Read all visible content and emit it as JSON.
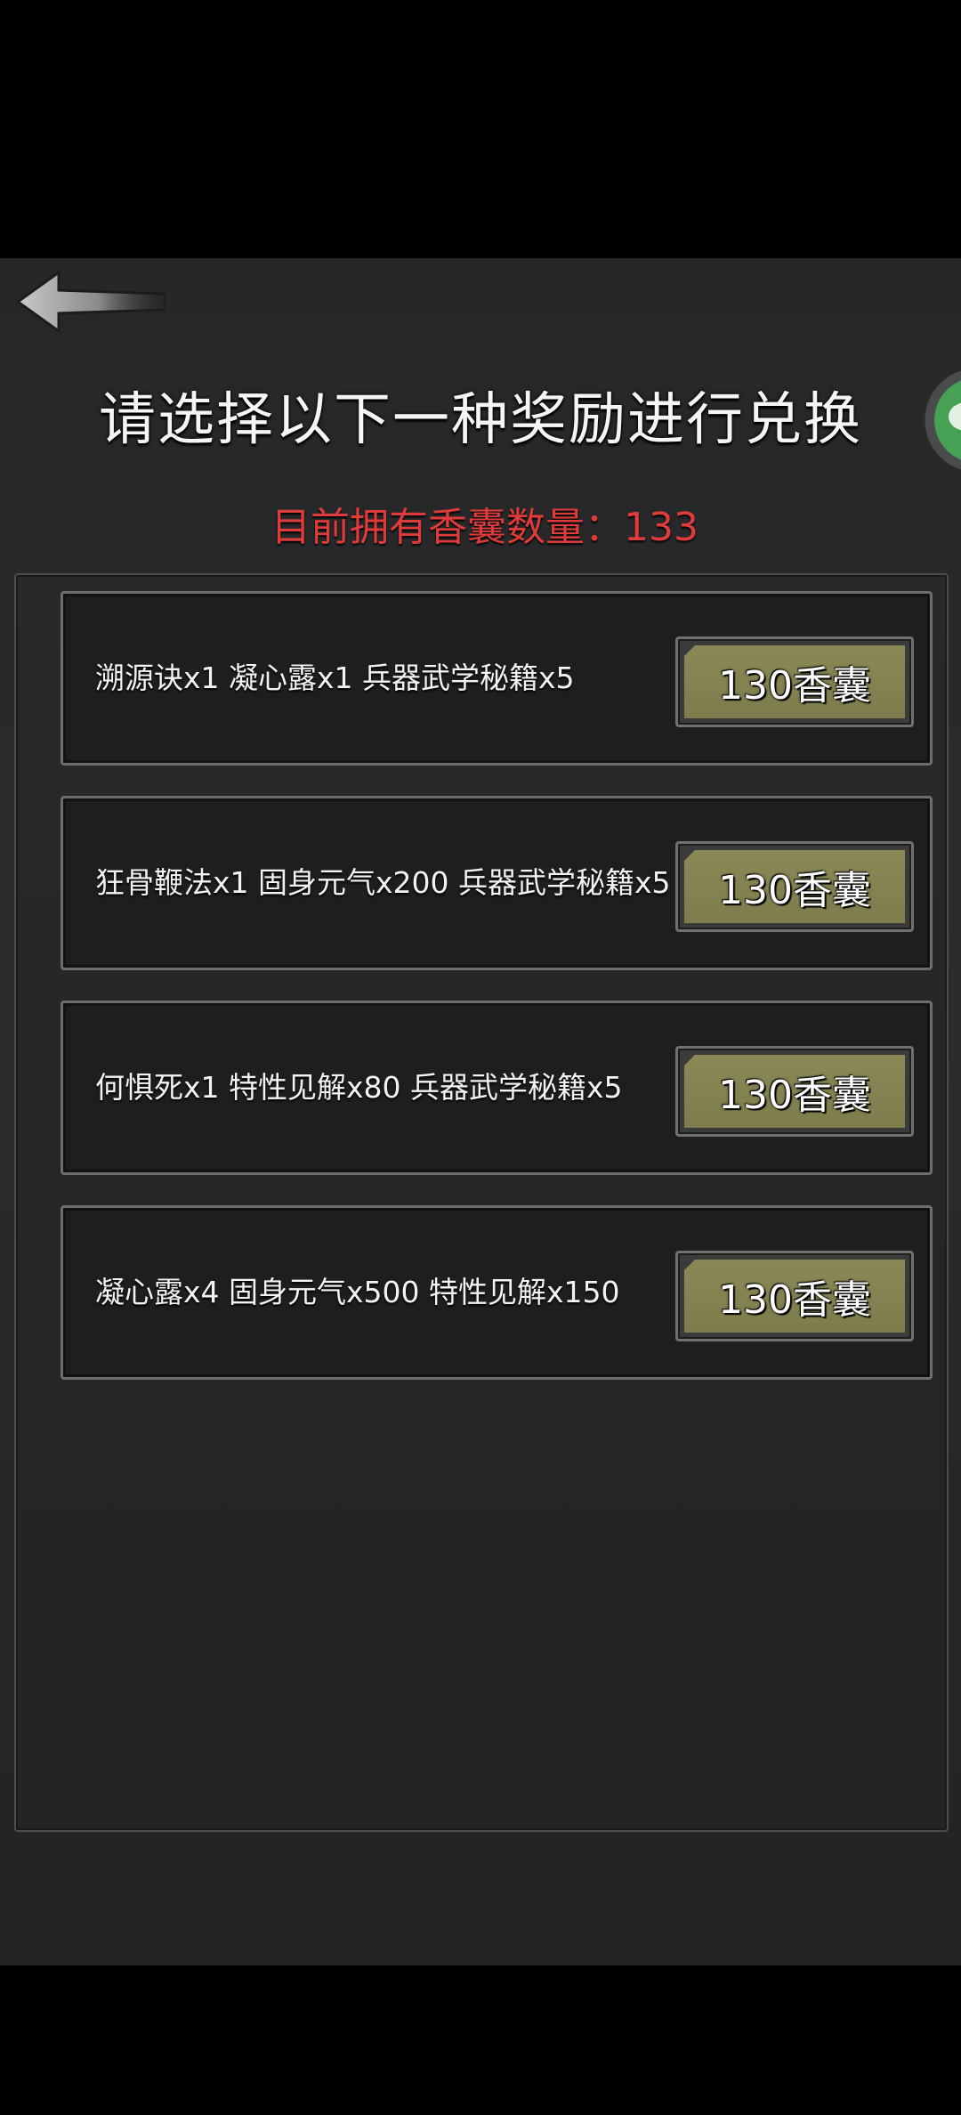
{
  "header": {
    "title": "请选择以下一种奖励进行兑换",
    "count_text": "目前拥有香囊数量：133"
  },
  "icons": {
    "back": "back-arrow-icon",
    "side": "chat-bubble-icon"
  },
  "rewards": [
    {
      "text": "溯源诀x1 凝心露x1 兵器武学秘籍x5",
      "button_label": "130香囊"
    },
    {
      "text": "狂骨鞭法x1 固身元气x200 兵器武学秘籍x5",
      "button_label": "130香囊"
    },
    {
      "text": "何惧死x1 特性见解x80 兵器武学秘籍x5",
      "button_label": "130香囊"
    },
    {
      "text": "凝心露x4 固身元气x500 特性见解x150",
      "button_label": "130香囊"
    }
  ],
  "colors": {
    "title": "#f5f5f5",
    "count": "#e03b3b",
    "button_fill": "#8a8956",
    "side_icon": "#47a155"
  }
}
